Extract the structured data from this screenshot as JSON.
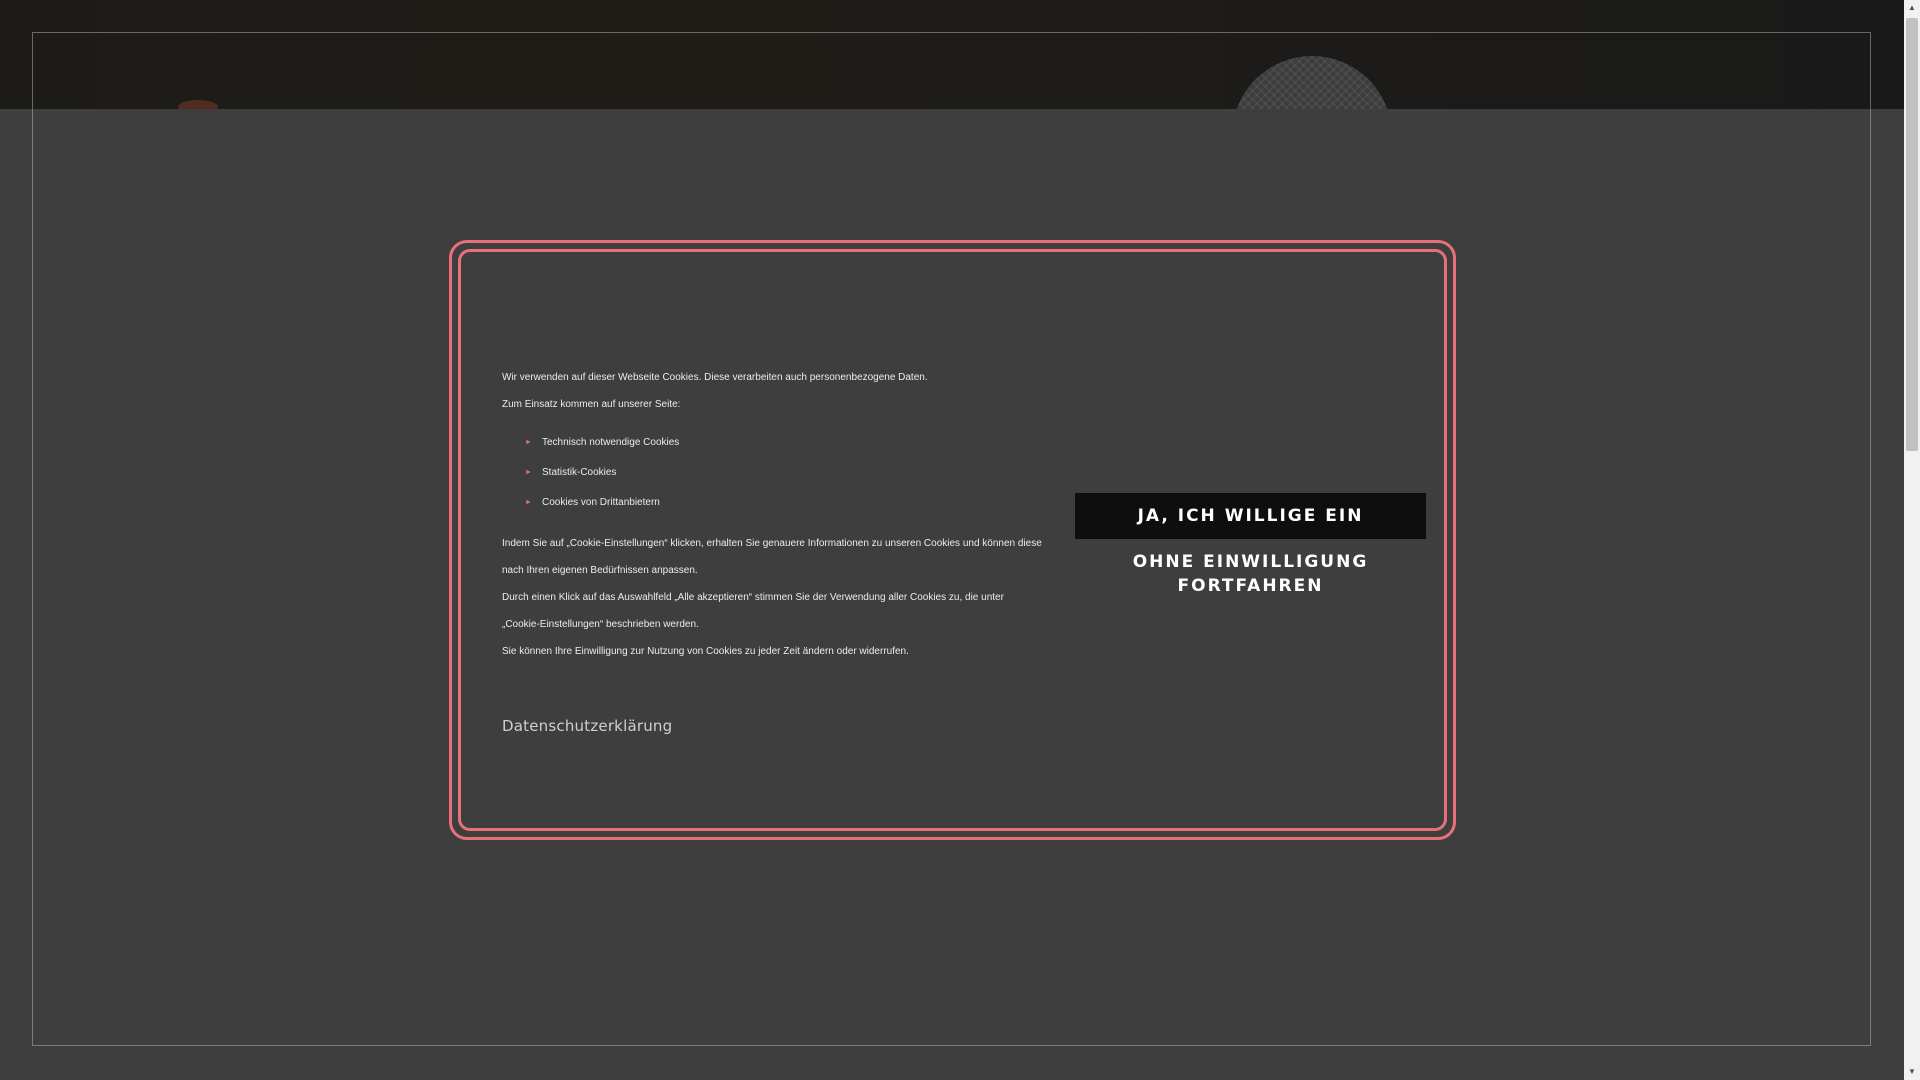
{
  "consent": {
    "intro_line1": "Wir verwenden auf dieser Webseite Cookies. Diese verarbeiten auch personenbezogene Daten.",
    "intro_line2": "Zum Einsatz kommen auf unserer Seite:",
    "cookie_types": [
      "Technisch notwendige Cookies",
      "Statistik-Cookies",
      "Cookies von Drittanbietern"
    ],
    "settings_info": "Indem Sie auf „Cookie-Einstellungen“ klicken, erhalten Sie genauere Informationen zu unseren Cookies und können diese nach Ihren eigenen Bedürfnissen anpassen.",
    "accept_all_info": "Durch einen Klick auf das Auswahlfeld „Alle akzeptieren“ stimmen Sie der Verwendung aller Cookies zu, die unter „Cookie-Einstellungen“ beschrieben werden.",
    "revoke_info": "Sie können Ihre Einwilligung zur Nutzung von Cookies zu jeder Zeit ändern oder widerrufen.",
    "privacy_link": "Datenschutzerklärung",
    "accept_button": "JA, ICH WILLIGE EIN",
    "decline_button": "OHNE EINWILLIGUNG FORTFAHREN"
  },
  "icons": {
    "bullet": "triangle-right-icon",
    "scroll_up": "arrow-up-icon",
    "scroll_down": "arrow-down-icon"
  },
  "colors": {
    "accent": "#e8707a",
    "overlay": "#3e3e3e",
    "accept_bg": "#0e0e0e"
  },
  "scrollbar": {
    "position_fraction": 0.0
  }
}
